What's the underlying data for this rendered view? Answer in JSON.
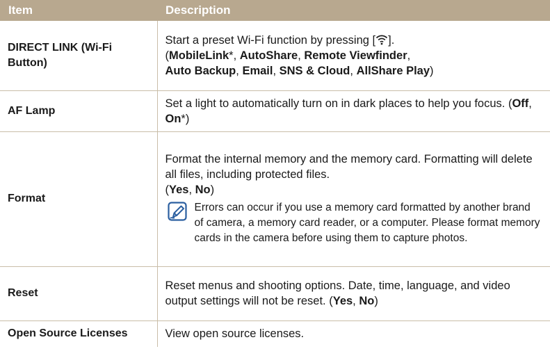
{
  "table": {
    "header": {
      "item": "Item",
      "description": "Description"
    },
    "rows": {
      "direct_link": {
        "item": "DIRECT LINK (Wi-Fi Button)",
        "line1_text": "Start a preset Wi-Fi function by pressing [",
        "line1_end": "].",
        "open_paren": "(",
        "opt1": "MobileLink",
        "asterisk": "*",
        "sep": ", ",
        "opt2": "AutoShare",
        "opt3": "Remote Viewfinder",
        "opt4": "Auto Backup",
        "opt5": "Email",
        "opt6": "SNS & Cloud",
        "opt7": "AllShare Play",
        "close_paren": ")"
      },
      "af_lamp": {
        "item": "AF Lamp",
        "text": "Set a light to automatically turn on in dark places to help you focus. (",
        "opt1": "Off",
        "sep": ", ",
        "opt2": "On",
        "asterisk": "*",
        "close_paren": ")"
      },
      "format": {
        "item": "Format",
        "text": "Format the internal memory and the memory card. Formatting will delete all files, including protected files.",
        "open_paren": "(",
        "opt1": "Yes",
        "sep": ", ",
        "opt2": "No",
        "close_paren": ")",
        "note": "Errors can occur if you use a memory card formatted by another brand of camera, a memory card reader, or a computer. Please format memory cards in the camera before using them to capture photos."
      },
      "reset": {
        "item": "Reset",
        "text": "Reset menus and shooting options. Date, time, language, and video output settings will not be reset. (",
        "opt1": "Yes",
        "sep": ", ",
        "opt2": "No",
        "close_paren": ")"
      },
      "open_source": {
        "item": "Open Source Licenses",
        "text": "View open source licenses."
      }
    }
  },
  "icons": {
    "wifi": "wifi-icon",
    "note": "note-pencil-icon"
  },
  "colors": {
    "header_bg": "#b8a88f",
    "rule": "#c9bda8",
    "note_icon": "#2b5fa0"
  }
}
